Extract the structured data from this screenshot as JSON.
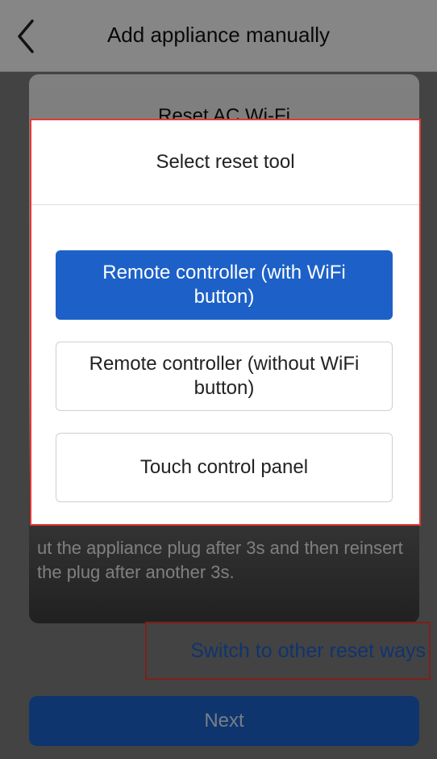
{
  "header": {
    "title": "Add appliance manually",
    "back_icon": "chevron-left-icon"
  },
  "card": {
    "title": "Reset AC Wi-Fi",
    "description": "ut the appliance plug after 3s and then reinsert the plug after another 3s."
  },
  "links": {
    "switch_reset": "Switch to other reset ways"
  },
  "footer": {
    "next_label": "Next"
  },
  "dialog": {
    "title": "Select reset tool",
    "options": [
      {
        "label": "Remote controller (with WiFi button)",
        "selected": true
      },
      {
        "label": "Remote controller (without WiFi button)",
        "selected": false
      },
      {
        "label": "Touch control panel",
        "selected": false
      }
    ]
  },
  "colors": {
    "accent": "#1d61c8",
    "highlight_border": "#e53935"
  }
}
